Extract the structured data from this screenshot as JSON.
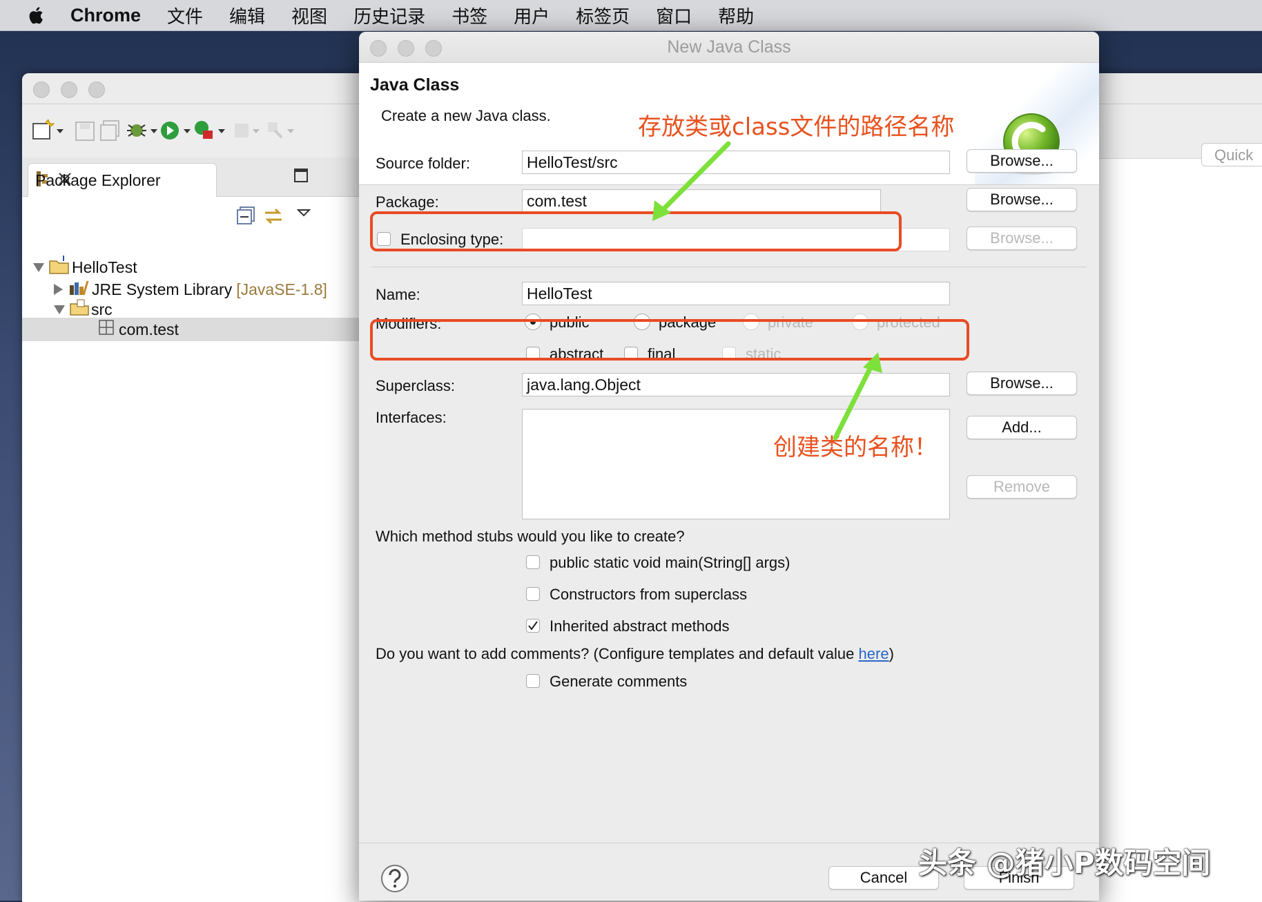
{
  "menubar": {
    "app": "Chrome",
    "items": [
      "文件",
      "编辑",
      "视图",
      "历史记录",
      "书签",
      "用户",
      "标签页",
      "窗口",
      "帮助"
    ]
  },
  "eclipse": {
    "quick_access": "Quick",
    "package_explorer": {
      "tab_label": "Package Explorer",
      "tree": {
        "project": "HelloTest",
        "jre_label": "JRE System Library",
        "jre_version": "[JavaSE-1.8]",
        "src": "src",
        "package": "com.test"
      }
    }
  },
  "dialog": {
    "title": "New Java Class",
    "heading": "Java Class",
    "subtitle": "Create a new Java class.",
    "source_folder": {
      "label": "Source folder:",
      "value": "HelloTest/src",
      "browse": "Browse..."
    },
    "package": {
      "label": "Package:",
      "value": "com.test",
      "browse": "Browse..."
    },
    "enclosing": {
      "label": "Enclosing type:",
      "value": "",
      "browse": "Browse..."
    },
    "name": {
      "label": "Name:",
      "value": "HelloTest"
    },
    "modifiers": {
      "label": "Modifiers:",
      "public": "public",
      "package": "package",
      "private": "private",
      "protected": "protected",
      "abstract": "abstract",
      "final": "final",
      "static": "static"
    },
    "superclass": {
      "label": "Superclass:",
      "value": "java.lang.Object",
      "browse": "Browse..."
    },
    "interfaces": {
      "label": "Interfaces:",
      "add": "Add...",
      "remove": "Remove"
    },
    "stubs": {
      "question": "Which method stubs would you like to create?",
      "main": "public static void main(String[] args)",
      "constructors": "Constructors from superclass",
      "inherited": "Inherited abstract methods"
    },
    "comments": {
      "question_prefix": "Do you want to add comments? (Configure templates and default value ",
      "link": "here",
      "question_suffix": ")",
      "generate": "Generate comments"
    },
    "footer": {
      "cancel": "Cancel",
      "finish": "Finish"
    }
  },
  "annotations": {
    "package_note": "存放类或class文件的路径名称",
    "name_note": "创建类的名称！"
  },
  "watermark": "头条 @猪小P数码空间",
  "colors": {
    "annotation": "#e84b25",
    "arrow": "#7ee03a",
    "link": "#2a66c9"
  }
}
